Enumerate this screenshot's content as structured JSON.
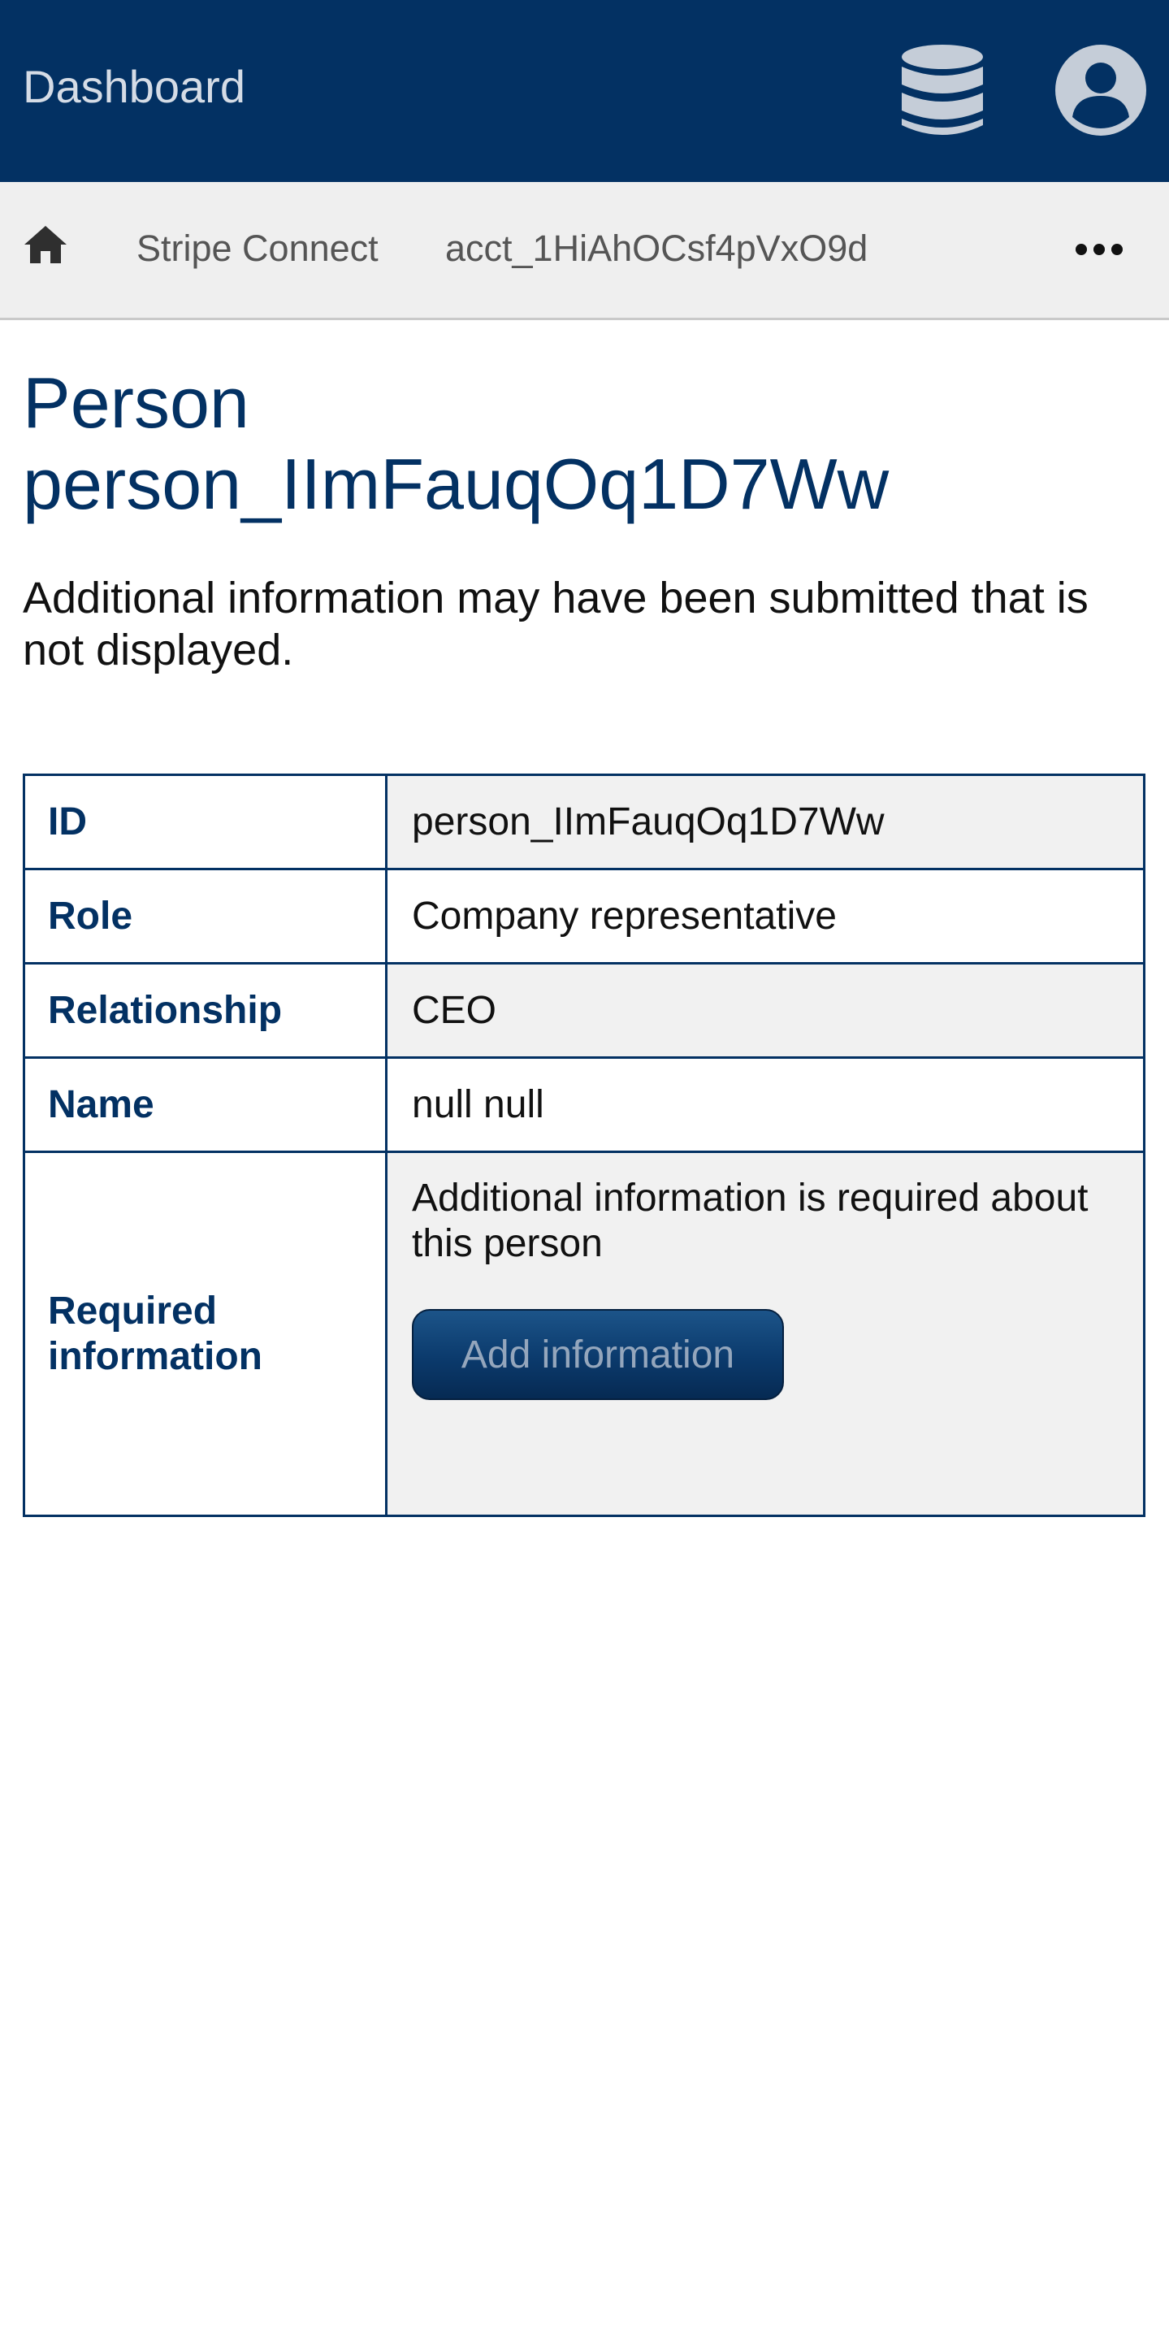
{
  "header": {
    "brand": "Dashboard",
    "icons": {
      "database": "database-icon",
      "user": "user-icon"
    }
  },
  "breadcrumb": {
    "home_icon": "home-icon",
    "items": [
      {
        "label": "Stripe Connect"
      },
      {
        "label": "acct_1HiAhOCsf4pVxO9d"
      }
    ],
    "more_icon": "more-icon"
  },
  "page": {
    "title_line1": "Person",
    "title_line2": "person_IImFauqOq1D7Ww",
    "notice": "Additional information may have been submitted that is not displayed."
  },
  "details": {
    "rows": [
      {
        "label": "ID",
        "value": "person_IImFauqOq1D7Ww"
      },
      {
        "label": "Role",
        "value": "Company representative"
      },
      {
        "label": "Relationship",
        "value": "CEO"
      },
      {
        "label": "Name",
        "value": "null null"
      }
    ],
    "required": {
      "label": "Required information",
      "text": "Additional information is required about this person",
      "button_label": "Add information"
    }
  },
  "colors": {
    "header_bg": "#033163",
    "accent": "#033163",
    "breadcrumb_bg": "#efefef",
    "alt_row_bg": "#f1f1f1"
  }
}
